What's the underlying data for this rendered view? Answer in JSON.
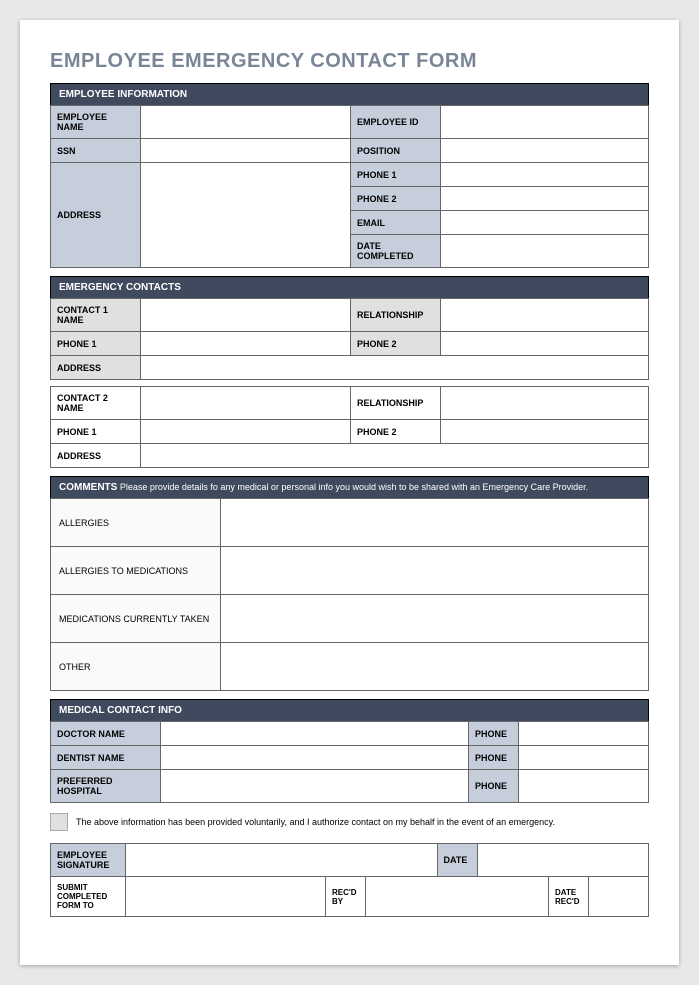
{
  "title": "EMPLOYEE EMERGENCY CONTACT FORM",
  "section1": {
    "header": "EMPLOYEE INFORMATION",
    "employee_name": "EMPLOYEE NAME",
    "employee_id": "EMPLOYEE ID",
    "ssn": "SSN",
    "position": "POSITION",
    "address": "ADDRESS",
    "phone1": "PHONE 1",
    "phone2": "PHONE 2",
    "email": "EMAIL",
    "date_completed": "DATE COMPLETED"
  },
  "section2": {
    "header": "EMERGENCY CONTACTS",
    "contact1_name": "CONTACT 1 NAME",
    "relationship": "RELATIONSHIP",
    "phone1": "PHONE 1",
    "phone2": "PHONE 2",
    "address": "ADDRESS",
    "contact2_name": "CONTACT 2 NAME"
  },
  "section3": {
    "header_bold": "COMMENTS",
    "header_note": " Please provide details fo any medical or personal info you would wish to be shared with an Emergency Care Provider.",
    "allergies": "ALLERGIES",
    "allergies_meds": "ALLERGIES TO MEDICATIONS",
    "meds_current": "MEDICATIONS CURRENTLY TAKEN",
    "other": "OTHER"
  },
  "section4": {
    "header": "MEDICAL CONTACT INFO",
    "doctor": "DOCTOR NAME",
    "dentist": "DENTIST NAME",
    "hospital": "PREFERRED HOSPITAL",
    "phone": "PHONE"
  },
  "auth_text": "The above information has been provided voluntarily, and I authorize contact on my behalf in the event of an emergency.",
  "sig": {
    "employee_signature": "EMPLOYEE SIGNATURE",
    "date": "DATE",
    "submit_to": "SUBMIT COMPLETED FORM TO",
    "recd_by": "REC'D BY",
    "date_recd": "DATE REC'D"
  }
}
